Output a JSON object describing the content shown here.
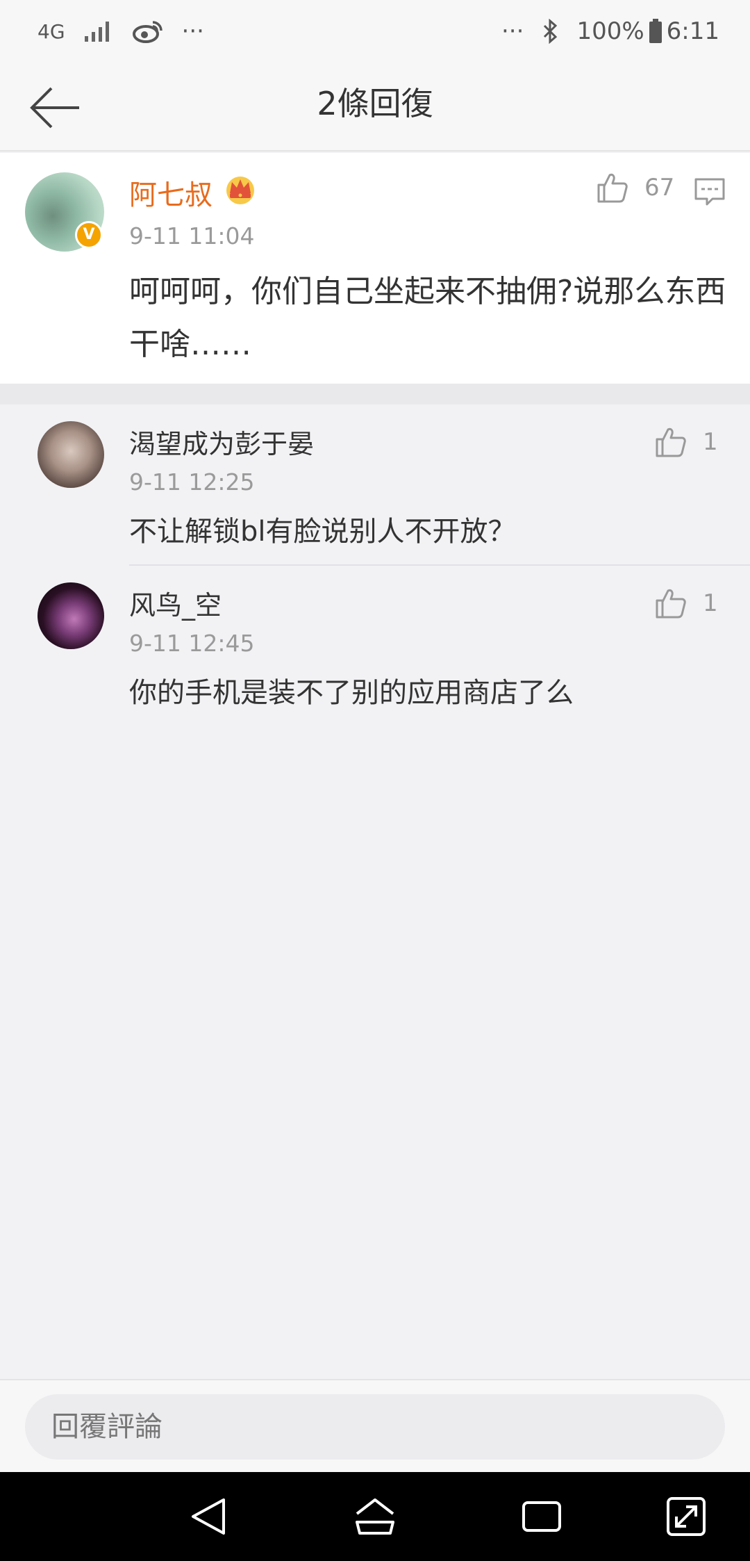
{
  "status_bar": {
    "network": "4G",
    "extra": "···",
    "right_extra": "···",
    "battery": "100%",
    "time": "6:11"
  },
  "nav": {
    "title": "2條回復"
  },
  "main_comment": {
    "author": "阿七叔",
    "time": "9-11 11:04",
    "likes": "67",
    "text": "呵呵呵，你们自己坐起来不抽佣?说那么东西干啥……",
    "badge": "V"
  },
  "replies": [
    {
      "author": "渴望成为彭于晏",
      "time": "9-11 12:25",
      "likes": "1",
      "text": "不让解锁bl有脸说别人不开放？"
    },
    {
      "author": "风鸟_空",
      "time": "9-11 12:45",
      "likes": "1",
      "text": "你的手机是装不了别的应用商店了么"
    }
  ],
  "bottom": {
    "placeholder": "回覆評論"
  },
  "colors": {
    "author_highlight": "#e86b1c",
    "background": "#f2f2f5",
    "verified": "#f4a300"
  },
  "icons": [
    "back-arrow-icon",
    "crown-icon",
    "thumb-up-icon",
    "comment-icon",
    "back-triangle-icon",
    "home-icon",
    "recents-icon",
    "expand-icon"
  ]
}
